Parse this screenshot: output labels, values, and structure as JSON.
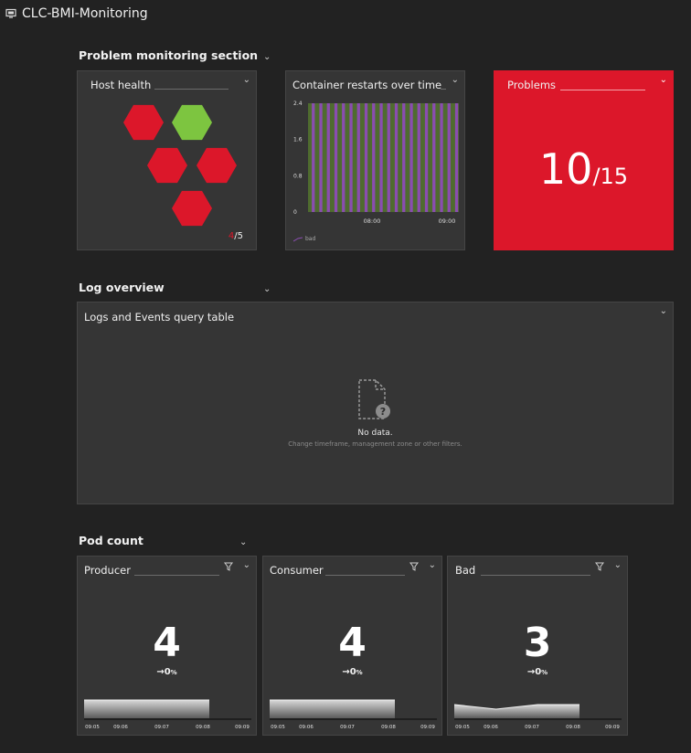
{
  "app": {
    "title": "CLC-BMI-Monitoring",
    "icon": "monitor-icon"
  },
  "sections": {
    "problem_monitoring": "Problem monitoring section",
    "log_overview": "Log overview",
    "pod_count": "Pod count"
  },
  "host_health": {
    "title": "Host health",
    "count_value": "4",
    "count_total": "/5",
    "hexagons": [
      "red",
      "green",
      "red",
      "red",
      "red"
    ],
    "colors": {
      "red": "#dc172a",
      "green": "#7dc540"
    }
  },
  "container_restarts": {
    "title": "Container restarts over time",
    "legend": "bad"
  },
  "problems": {
    "title": "Problems",
    "count": "10",
    "total": "/15"
  },
  "logs": {
    "title": "Logs and Events query table",
    "no_data": "No data.",
    "no_data_hint": "Change timeframe, management zone or other filters."
  },
  "pods": [
    {
      "title": "Producer",
      "value": "4",
      "trend": "→0",
      "unit": "%"
    },
    {
      "title": "Consumer",
      "value": "4",
      "trend": "→0",
      "unit": "%"
    },
    {
      "title": "Bad",
      "value": "3",
      "trend": "→0",
      "unit": "%"
    }
  ],
  "pod_axis": [
    "09:05",
    "09:06",
    "09:07",
    "09:08",
    "09:09"
  ],
  "chart_data": [
    {
      "type": "bar",
      "title": "Container restarts over time",
      "series": [
        {
          "name": "bad",
          "values": [
            0,
            2.4,
            0,
            2.4,
            0,
            2.4,
            0,
            2.4,
            0,
            2.4,
            0,
            2.4,
            0,
            2.4,
            0,
            2.4,
            0,
            2.4,
            0,
            2.4,
            0,
            2.4,
            0,
            2.4,
            0,
            2.4,
            0,
            2.4,
            0,
            2.4,
            0,
            2.4,
            0,
            2.4,
            0,
            2.4,
            0,
            2.4,
            0,
            2.4
          ]
        }
      ],
      "yticks": [
        "2.4",
        "1.6",
        "0.8",
        "0"
      ],
      "xticks": [
        "08:00",
        "09:00"
      ],
      "ylim": [
        0,
        2.4
      ],
      "colors": {
        "series": "#8a4db0",
        "background": "#4f6b2f"
      }
    },
    {
      "type": "area",
      "title": "Producer",
      "x": [
        "09:05",
        "09:06",
        "09:07",
        "09:08",
        "09:09"
      ],
      "values": [
        4,
        4,
        4,
        4
      ]
    },
    {
      "type": "area",
      "title": "Consumer",
      "x": [
        "09:05",
        "09:06",
        "09:07",
        "09:08",
        "09:09"
      ],
      "values": [
        4,
        4,
        4,
        4
      ]
    },
    {
      "type": "area",
      "title": "Bad",
      "x": [
        "09:05",
        "09:06",
        "09:07",
        "09:08",
        "09:09"
      ],
      "values": [
        3,
        2,
        3,
        3
      ]
    }
  ]
}
